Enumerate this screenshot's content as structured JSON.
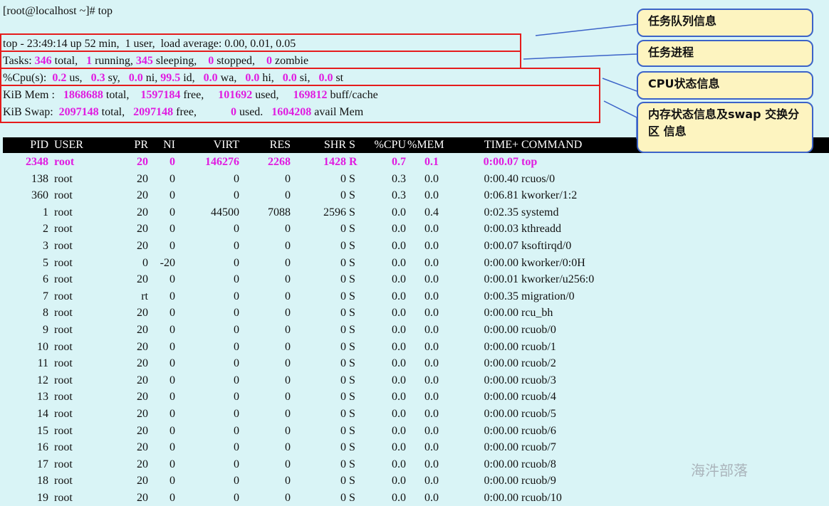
{
  "prompt": "[root@localhost ~]# top",
  "summary": {
    "top": "top - 23:49:14 up 52 min,  1 user,  load average: 0.00, 0.01, 0.05",
    "tasks": {
      "label": "Tasks:",
      "total": "346",
      "total_label": "total,",
      "running": "1",
      "running_label": "running,",
      "sleeping": "345",
      "sleeping_label": "sleeping,",
      "stopped": "0",
      "stopped_label": "stopped,",
      "zombie": "0",
      "zombie_label": "zombie"
    },
    "cpu": {
      "label": "%Cpu(s):",
      "us": "0.2",
      "sy": "0.3",
      "ni": "0.0",
      "id": "99.5",
      "wa": "0.0",
      "hi": "0.0",
      "si": "0.0",
      "st": "0.0"
    },
    "mem": {
      "label": "KiB Mem :",
      "total": "1868688",
      "free": "1597184",
      "used": "101692",
      "buff": "169812",
      "buff_label": "buff/cache"
    },
    "swap": {
      "label": "KiB Swap:",
      "total": "2097148",
      "free": "2097148",
      "used": "0",
      "avail": "1604208",
      "avail_label": "avail Mem"
    }
  },
  "columns": [
    "PID",
    "USER",
    "PR",
    "NI",
    "VIRT",
    "RES",
    "SHR",
    "S",
    "%CPU",
    "%MEM",
    "TIME+",
    "COMMAND"
  ],
  "processes": [
    [
      "2348",
      "root",
      "20",
      "0",
      "146276",
      "2268",
      "1428",
      "R",
      "0.7",
      "0.1",
      "0:00.07",
      "top"
    ],
    [
      "138",
      "root",
      "20",
      "0",
      "0",
      "0",
      "0",
      "S",
      "0.3",
      "0.0",
      "0:00.40",
      "rcuos/0"
    ],
    [
      "360",
      "root",
      "20",
      "0",
      "0",
      "0",
      "0",
      "S",
      "0.3",
      "0.0",
      "0:06.81",
      "kworker/1:2"
    ],
    [
      "1",
      "root",
      "20",
      "0",
      "44500",
      "7088",
      "2596",
      "S",
      "0.0",
      "0.4",
      "0:02.35",
      "systemd"
    ],
    [
      "2",
      "root",
      "20",
      "0",
      "0",
      "0",
      "0",
      "S",
      "0.0",
      "0.0",
      "0:00.03",
      "kthreadd"
    ],
    [
      "3",
      "root",
      "20",
      "0",
      "0",
      "0",
      "0",
      "S",
      "0.0",
      "0.0",
      "0:00.07",
      "ksoftirqd/0"
    ],
    [
      "5",
      "root",
      "0",
      "-20",
      "0",
      "0",
      "0",
      "S",
      "0.0",
      "0.0",
      "0:00.00",
      "kworker/0:0H"
    ],
    [
      "6",
      "root",
      "20",
      "0",
      "0",
      "0",
      "0",
      "S",
      "0.0",
      "0.0",
      "0:00.01",
      "kworker/u256:0"
    ],
    [
      "7",
      "root",
      "rt",
      "0",
      "0",
      "0",
      "0",
      "S",
      "0.0",
      "0.0",
      "0:00.35",
      "migration/0"
    ],
    [
      "8",
      "root",
      "20",
      "0",
      "0",
      "0",
      "0",
      "S",
      "0.0",
      "0.0",
      "0:00.00",
      "rcu_bh"
    ],
    [
      "9",
      "root",
      "20",
      "0",
      "0",
      "0",
      "0",
      "S",
      "0.0",
      "0.0",
      "0:00.00",
      "rcuob/0"
    ],
    [
      "10",
      "root",
      "20",
      "0",
      "0",
      "0",
      "0",
      "S",
      "0.0",
      "0.0",
      "0:00.00",
      "rcuob/1"
    ],
    [
      "11",
      "root",
      "20",
      "0",
      "0",
      "0",
      "0",
      "S",
      "0.0",
      "0.0",
      "0:00.00",
      "rcuob/2"
    ],
    [
      "12",
      "root",
      "20",
      "0",
      "0",
      "0",
      "0",
      "S",
      "0.0",
      "0.0",
      "0:00.00",
      "rcuob/3"
    ],
    [
      "13",
      "root",
      "20",
      "0",
      "0",
      "0",
      "0",
      "S",
      "0.0",
      "0.0",
      "0:00.00",
      "rcuob/4"
    ],
    [
      "14",
      "root",
      "20",
      "0",
      "0",
      "0",
      "0",
      "S",
      "0.0",
      "0.0",
      "0:00.00",
      "rcuob/5"
    ],
    [
      "15",
      "root",
      "20",
      "0",
      "0",
      "0",
      "0",
      "S",
      "0.0",
      "0.0",
      "0:00.00",
      "rcuob/6"
    ],
    [
      "16",
      "root",
      "20",
      "0",
      "0",
      "0",
      "0",
      "S",
      "0.0",
      "0.0",
      "0:00.00",
      "rcuob/7"
    ],
    [
      "17",
      "root",
      "20",
      "0",
      "0",
      "0",
      "0",
      "S",
      "0.0",
      "0.0",
      "0:00.00",
      "rcuob/8"
    ],
    [
      "18",
      "root",
      "20",
      "0",
      "0",
      "0",
      "0",
      "S",
      "0.0",
      "0.0",
      "0:00.00",
      "rcuob/9"
    ],
    [
      "19",
      "root",
      "20",
      "0",
      "0",
      "0",
      "0",
      "S",
      "0.0",
      "0.0",
      "0:00.00",
      "rcuob/10"
    ]
  ],
  "callouts": {
    "queue": "任务队列信息",
    "tasks": "任务进程",
    "cpu": "CPU状态信息",
    "mem": "内存状态信息及swap 交换分区 信息"
  },
  "watermark": "海汼部落",
  "colors": {
    "background": "#d9f4f6",
    "highlight": "#e01be0",
    "box": "#e51c1c",
    "callout_bg": "#fdf4c0",
    "callout_border": "#3c63c8"
  }
}
